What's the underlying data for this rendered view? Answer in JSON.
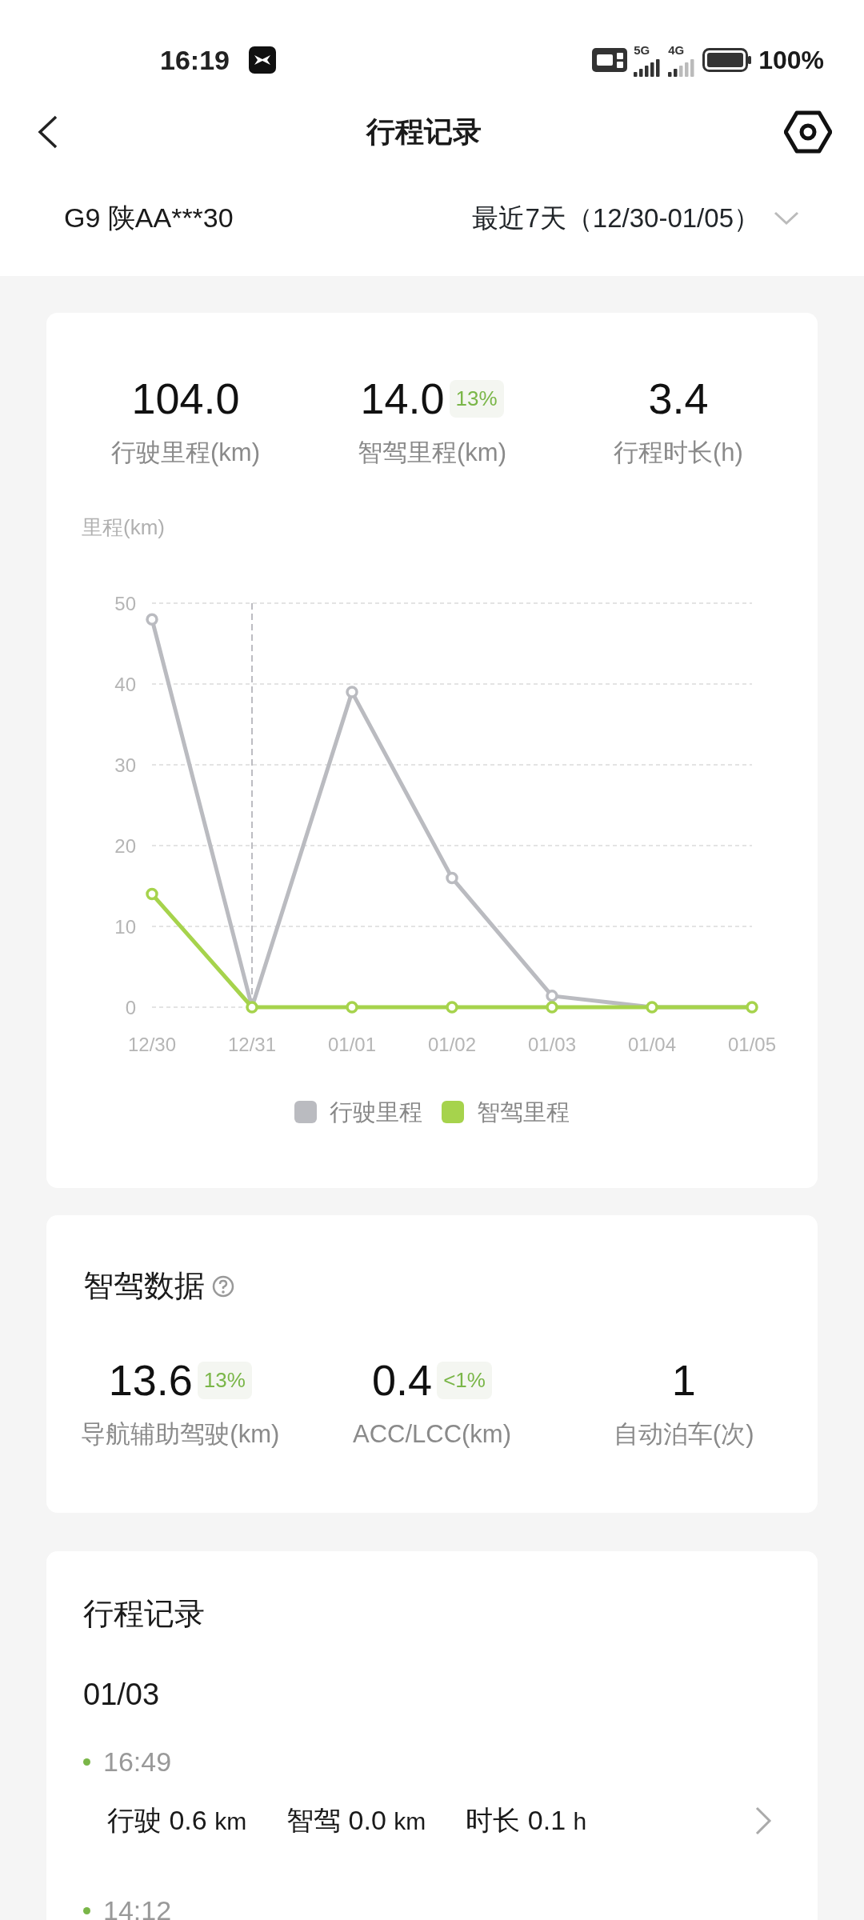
{
  "status_bar": {
    "time": "16:19",
    "networks": [
      {
        "label": "5G"
      },
      {
        "label": "4G"
      }
    ],
    "battery": "100%"
  },
  "header": {
    "title": "行程记录"
  },
  "selector": {
    "vehicle": "G9 陕AA***30",
    "range": "最近7天（12/30-01/05）"
  },
  "summary": {
    "stats": [
      {
        "value": "104.0",
        "label": "行驶里程(km)"
      },
      {
        "value": "14.0",
        "badge": "13%",
        "label": "智驾里程(km)"
      },
      {
        "value": "3.4",
        "label": "行程时长(h)"
      }
    ],
    "chart_data": {
      "type": "line",
      "ylabel": "里程(km)",
      "categories": [
        "12/30",
        "12/31",
        "01/01",
        "01/02",
        "01/03",
        "01/04",
        "01/05"
      ],
      "ylim": [
        0,
        50
      ],
      "yticks": [
        0,
        10,
        20,
        30,
        40,
        50
      ],
      "grid": true,
      "series": [
        {
          "name": "行驶里程",
          "color": "#babbc0",
          "marker": "circle",
          "values": [
            48,
            0,
            39,
            16,
            1.4,
            0,
            0
          ]
        },
        {
          "name": "智驾里程",
          "color": "#a6d34c",
          "marker": "circle",
          "values": [
            14,
            0,
            0,
            0,
            0,
            0,
            0
          ]
        }
      ],
      "ref_lines": [
        {
          "axis": "x",
          "value": "12/31"
        }
      ]
    }
  },
  "assist": {
    "title": "智驾数据",
    "stats": [
      {
        "value": "13.6",
        "badge": "13%",
        "label": "导航辅助驾驶(km)"
      },
      {
        "value": "0.4",
        "badge": "<1%",
        "label": "ACC/LCC(km)"
      },
      {
        "value": "1",
        "label": "自动泊车(次)"
      }
    ]
  },
  "trips": {
    "title": "行程记录",
    "days": [
      {
        "date": "01/03",
        "items": [
          {
            "time": "16:49",
            "fields": [
              {
                "label": "行驶",
                "value": "0.6",
                "unit": "km"
              },
              {
                "label": "智驾",
                "value": "0.0",
                "unit": "km"
              },
              {
                "label": "时长",
                "value": "0.1",
                "unit": "h"
              }
            ]
          },
          {
            "time": "14:12"
          }
        ]
      }
    ]
  }
}
